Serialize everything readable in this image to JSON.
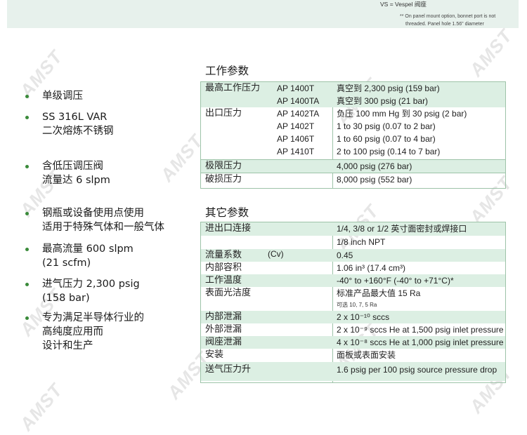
{
  "top_note": {
    "vs_line": "VS  =  Vespel 阀座",
    "note_line1": "** On panel mount option, bonnet port is not",
    "note_line2": "threaded. Panel hole 1.56\" diameter"
  },
  "watermark_text": "AMST",
  "features": [
    {
      "lines": [
        "单级调压"
      ]
    },
    {
      "lines": [
        "SS 316L VAR",
        "二次熔炼不锈钢"
      ]
    },
    {
      "lines": [
        "含低压调压阀",
        "流量达 6 slpm"
      ]
    },
    {
      "lines": [
        "钢瓶或设备使用点使用",
        "适用于特殊气体和一般气体"
      ]
    },
    {
      "lines": [
        "最高流量 600 slpm",
        "(21 scfm)"
      ]
    },
    {
      "lines": [
        "进气压力 2,300 psig",
        "(158 bar)"
      ]
    },
    {
      "lines": [
        "专为满足半导体行业的",
        "高纯度应用而",
        "设计和生产"
      ]
    }
  ],
  "working_params": {
    "title": "工作参数",
    "rows": [
      {
        "label": "最高工作压力",
        "model": "AP 1400T",
        "value": "真空到      2,300 psig (159 bar)"
      },
      {
        "label": "",
        "model": "AP 1400TA",
        "value": "真空到      300 psig (21 bar)"
      },
      {
        "label": "出口压力",
        "model": "AP 1402TA",
        "value": "负压 100 mm Hg  到     30 psig (2 bar)"
      },
      {
        "label": "",
        "model": "AP 1402T",
        "value": "1 to 30 psig (0.07 to 2 bar)"
      },
      {
        "label": "",
        "model": "AP 1406T",
        "value": "1 to 60 psig (0.07 to 4 bar)"
      },
      {
        "label": "",
        "model": "AP 1410T",
        "value": "2 to 100 psig (0.14 to 7 bar)"
      },
      {
        "label": "极限压力",
        "model": "",
        "value": "4,000 psig (276 bar)"
      },
      {
        "label": "破损压力",
        "model": "",
        "value": "8,000 psig (552 bar)"
      }
    ]
  },
  "other_params": {
    "title": "其它参数",
    "rows": [
      {
        "label": "进出口连接",
        "value": "1/4, 3/8 or 1/2 英寸面密封或焊接口"
      },
      {
        "label": "",
        "value": "1/8 inch NPT"
      },
      {
        "label": "流量系数",
        "extra": "(Cv)",
        "value": "0.45"
      },
      {
        "label": "内部容积",
        "value": "1.06 in³ (17.4 cm³)"
      },
      {
        "label": "工作温度",
        "value": "-40° to +160°F (-40° to +71°C)*"
      },
      {
        "label": "表面光洁度",
        "value": "标准产品最大值 15 Ra",
        "sub": "可选 10, 7, 5 Ra"
      },
      {
        "label": "内部泄漏",
        "value": "2 x 10⁻¹⁰ sccs"
      },
      {
        "label": "外部泄漏",
        "value": "2 x 10⁻⁹ sccs He at 1,500 psig inlet pressure"
      },
      {
        "label": "阀座泄漏",
        "value": "4 x 10⁻⁸ sccs He at 1,000 psig inlet pressure"
      },
      {
        "label": "安装",
        "value": "面板或表面安装"
      },
      {
        "label": "送气压力升",
        "value": "1.6 psig per 100 psig source pressure drop"
      }
    ]
  }
}
